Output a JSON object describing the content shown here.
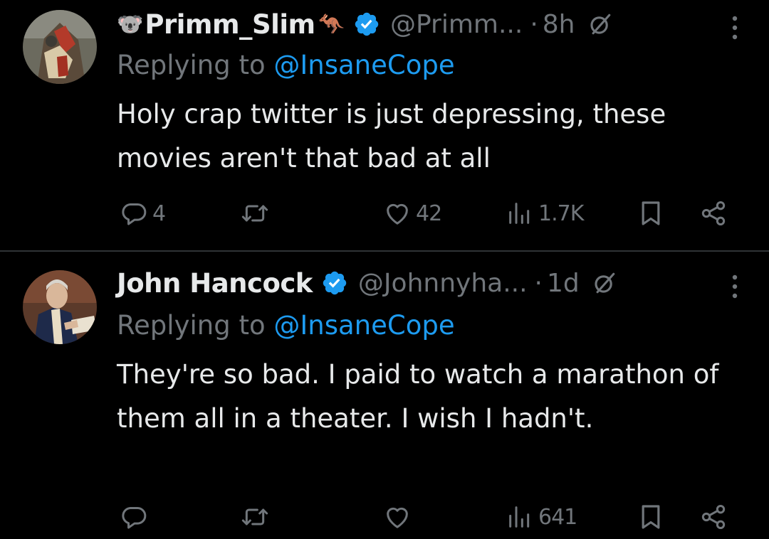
{
  "tweets": [
    {
      "avatar": "avatar-image",
      "name_prefix_emoji": "🐨",
      "display_name": "Primm_Slim",
      "name_suffix_emoji": "🦘",
      "verified": true,
      "handle": "@Primm...",
      "separator": "·",
      "time": "8h",
      "replying_prefix": "Replying to ",
      "replying_to": "@InsaneCope",
      "text": "Holy crap twitter is just depressing, these movies aren't that bad at all",
      "replies": "4",
      "retweets": "",
      "likes": "42",
      "views": "1.7K"
    },
    {
      "avatar": "avatar-image",
      "name_prefix_emoji": "",
      "display_name": "John Hancock",
      "name_suffix_emoji": "",
      "verified": true,
      "handle": "@Johnnyha...",
      "separator": "·",
      "time": "1d",
      "replying_prefix": "Replying to ",
      "replying_to": "@InsaneCope",
      "text": "They're so bad. I paid to watch a marathon of them all in a theater. I wish I hadn't.",
      "replies": "",
      "retweets": "",
      "likes": "",
      "views": "641"
    }
  ],
  "icons": {
    "verified": "verified-badge-icon",
    "grok": "grok-icon",
    "more": "more-icon",
    "reply": "reply-icon",
    "retweet": "retweet-icon",
    "like": "heart-icon",
    "views": "views-icon",
    "bookmark": "bookmark-icon",
    "share": "share-icon"
  },
  "colors": {
    "background": "#000000",
    "text": "#e7e9ea",
    "muted": "#71767b",
    "accent": "#1d9bf0",
    "divider": "#2f3336"
  }
}
